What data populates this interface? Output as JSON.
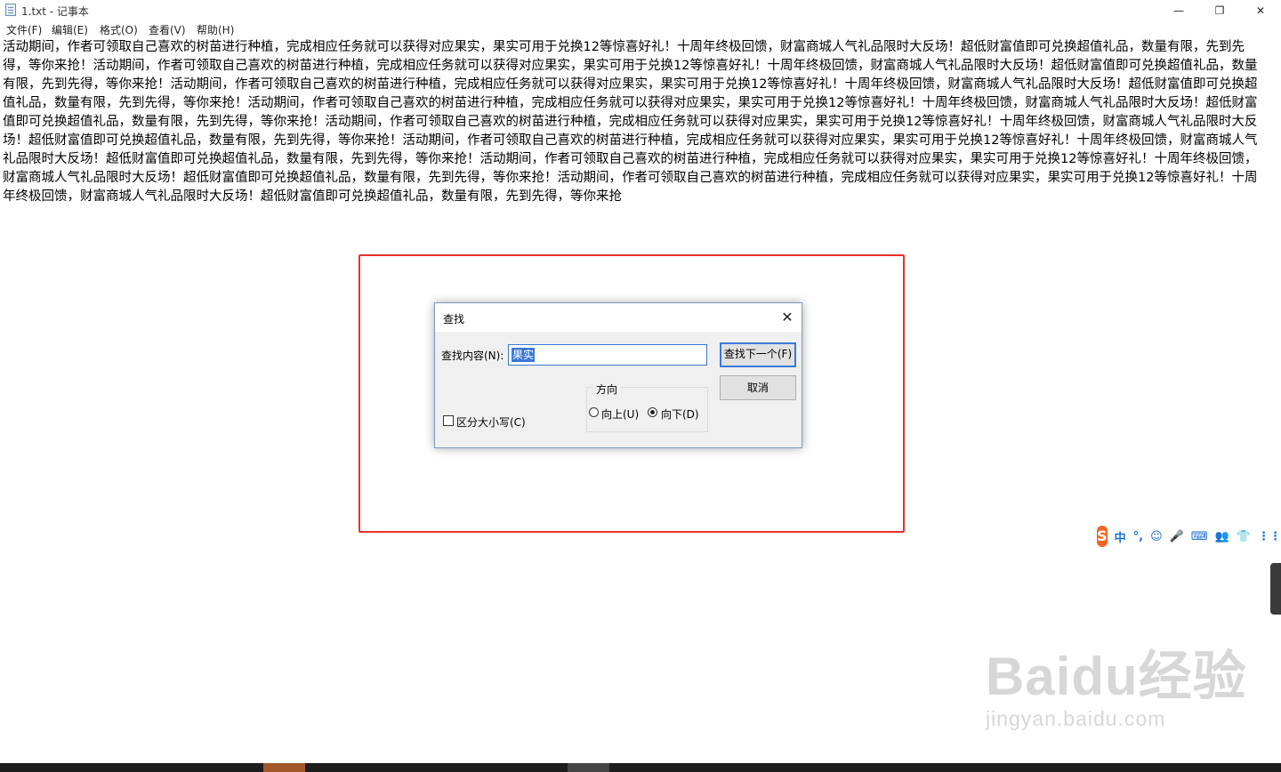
{
  "window": {
    "title": "1.txt - 记事本",
    "min_glyph": "—",
    "max_glyph": "❐",
    "close_glyph": "✕"
  },
  "menu": {
    "file": "文件(F)",
    "edit": "编辑(E)",
    "format": "格式(O)",
    "view": "查看(V)",
    "help": "帮助(H)"
  },
  "document": {
    "text": "活动期间，作者可领取自己喜欢的树苗进行种植，完成相应任务就可以获得对应果实，果实可用于兑换12等惊喜好礼！十周年终极回馈，财富商城人气礼品限时大反场！超低财富值即可兑换超值礼品，数量有限，先到先得，等你来抢！活动期间，作者可领取自己喜欢的树苗进行种植，完成相应任务就可以获得对应果实，果实可用于兑换12等惊喜好礼！十周年终极回馈，财富商城人气礼品限时大反场！超低财富值即可兑换超值礼品，数量有限，先到先得，等你来抢！活动期间，作者可领取自己喜欢的树苗进行种植，完成相应任务就可以获得对应果实，果实可用于兑换12等惊喜好礼！十周年终极回馈，财富商城人气礼品限时大反场！超低财富值即可兑换超值礼品，数量有限，先到先得，等你来抢！活动期间，作者可领取自己喜欢的树苗进行种植，完成相应任务就可以获得对应果实，果实可用于兑换12等惊喜好礼！十周年终极回馈，财富商城人气礼品限时大反场！超低财富值即可兑换超值礼品，数量有限，先到先得，等你来抢！活动期间，作者可领取自己喜欢的树苗进行种植，完成相应任务就可以获得对应果实，果实可用于兑换12等惊喜好礼！十周年终极回馈，财富商城人气礼品限时大反场！超低财富值即可兑换超值礼品，数量有限，先到先得，等你来抢！活动期间，作者可领取自己喜欢的树苗进行种植，完成相应任务就可以获得对应果实，果实可用于兑换12等惊喜好礼！十周年终极回馈，财富商城人气礼品限时大反场！超低财富值即可兑换超值礼品，数量有限，先到先得，等你来抢！活动期间，作者可领取自己喜欢的树苗进行种植，完成相应任务就可以获得对应果实，果实可用于兑换12等惊喜好礼！十周年终极回馈，财富商城人气礼品限时大反场！超低财富值即可兑换超值礼品，数量有限，先到先得，等你来抢！活动期间，作者可领取自己喜欢的树苗进行种植，完成相应任务就可以获得对应果实，果实可用于兑换12等惊喜好礼！十周年终极回馈，财富商城人气礼品限时大反场！超低财富值即可兑换超值礼品，数量有限，先到先得，等你来抢"
  },
  "find_dialog": {
    "title": "查找",
    "close_glyph": "✕",
    "find_label": "查找内容(N):",
    "find_value": "果实",
    "find_next": "查找下一个(F)",
    "cancel": "取消",
    "direction_label": "方向",
    "up_label": "向上(U)",
    "down_label": "向下(D)",
    "direction_selected": "down",
    "match_case_label": "区分大小写(C)",
    "match_case_checked": false
  },
  "ime": {
    "logo": "S",
    "items": [
      "中",
      "°,",
      "☺",
      "🎤",
      "⌨",
      "👥",
      "👕",
      "⋮⋮"
    ]
  },
  "watermark": {
    "main": "Baidu经验",
    "sub": "jingyan.baidu.com"
  },
  "colors": {
    "annotation_red": "#e8302a",
    "selection_blue": "#3b78d6"
  }
}
